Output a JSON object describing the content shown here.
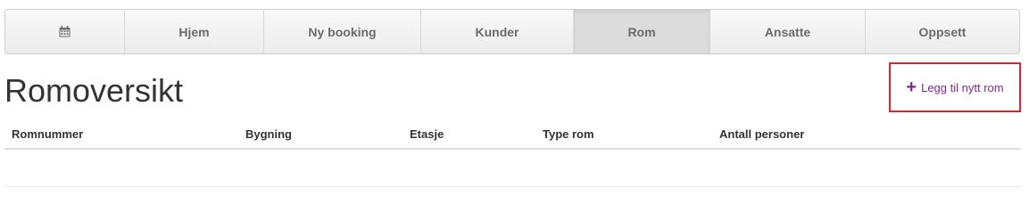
{
  "nav": {
    "calendar_icon": "calendar-icon",
    "items": [
      {
        "label": "Hjem"
      },
      {
        "label": "Ny booking"
      },
      {
        "label": "Kunder"
      },
      {
        "label": "Rom",
        "active": true
      },
      {
        "label": "Ansatte"
      },
      {
        "label": "Oppsett"
      }
    ]
  },
  "page": {
    "title": "Romoversikt"
  },
  "actions": {
    "add_room_label": "Legg til nytt rom",
    "add_room_icon": "plus-icon",
    "accent_color": "#7d2a8c",
    "highlight_color": "#d7242f"
  },
  "table": {
    "columns": [
      "Romnummer",
      "Bygning",
      "Etasje",
      "Type rom",
      "Antall personer"
    ],
    "rows": []
  }
}
